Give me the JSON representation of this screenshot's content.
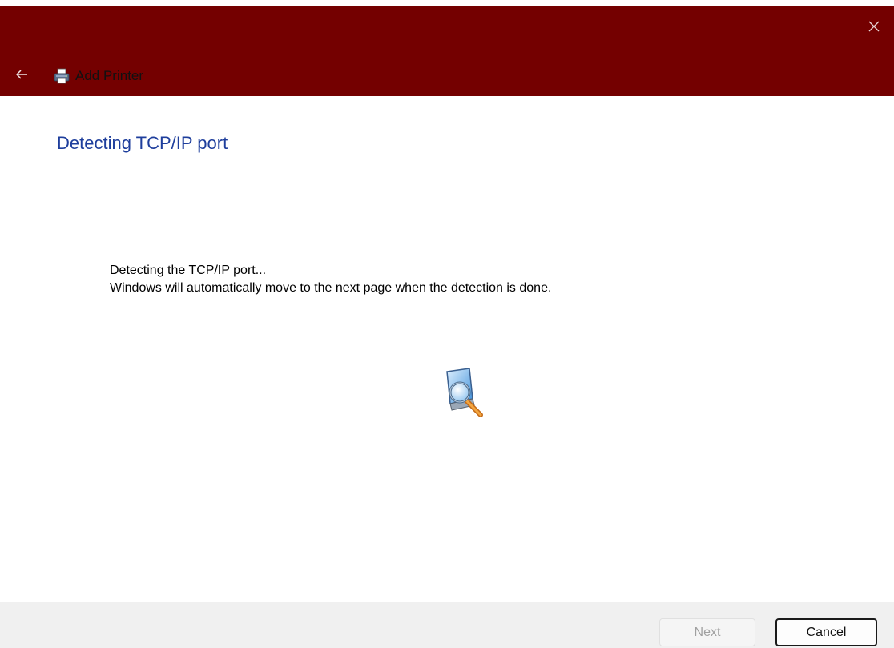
{
  "window": {
    "title": "Add Printer",
    "accent_color": "#740000"
  },
  "icons": {
    "back": "back-arrow-icon",
    "close": "close-icon",
    "app": "printer-icon",
    "progress": "search-computer-icon"
  },
  "page": {
    "heading": "Detecting TCP/IP port",
    "status_line1": "Detecting the TCP/IP port...",
    "status_line2": "Windows will automatically move to the next page when the detection is done."
  },
  "footer": {
    "next_label": "Next",
    "cancel_label": "Cancel",
    "next_enabled": false
  }
}
